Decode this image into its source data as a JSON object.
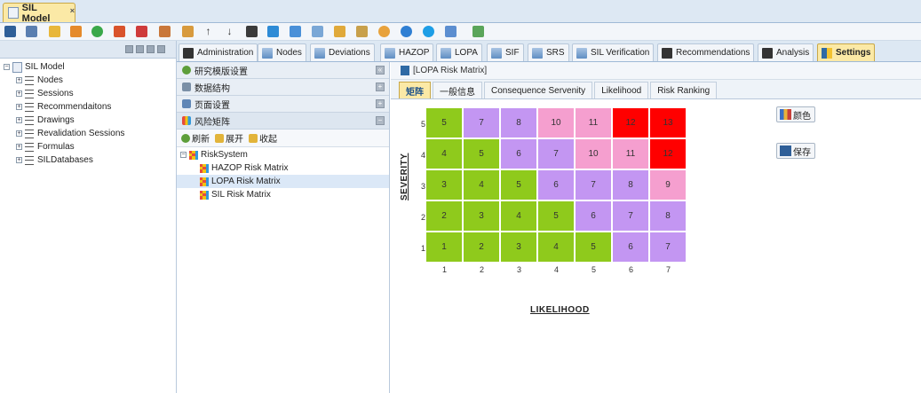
{
  "document_tab": {
    "title": "SIL Model",
    "close": "×"
  },
  "toolbar": {
    "icons": [
      "save-icon",
      "save-as-icon",
      "folder-icon",
      "edit-icon",
      "add-icon",
      "cut-icon",
      "delete-icon",
      "copy-icon",
      "paste-icon",
      "up-arrow-icon",
      "down-arrow-icon",
      "indent-icon",
      "table-icon",
      "window-icon",
      "grid-icon",
      "filter-icon",
      "tool-icon",
      "plugin-icon",
      "refresh-icon",
      "help-icon",
      "dropdown-icon",
      "export-icon"
    ],
    "up": "↑",
    "down": "↓"
  },
  "tree": {
    "root": "SIL Model",
    "items": [
      {
        "label": "Nodes"
      },
      {
        "label": "Sessions"
      },
      {
        "label": "Recommendaitons"
      },
      {
        "label": "Drawings"
      },
      {
        "label": "Revalidation Sessions"
      },
      {
        "label": "Formulas"
      },
      {
        "label": "SILDatabases"
      }
    ]
  },
  "main_tabs": [
    {
      "label": "Administration",
      "icon": "dark"
    },
    {
      "label": "Nodes",
      "icon": "blue"
    },
    {
      "label": "Deviations",
      "icon": "blue"
    },
    {
      "label": "HAZOP",
      "icon": "blue"
    },
    {
      "label": "LOPA",
      "icon": "blue"
    },
    {
      "label": "SIF",
      "icon": "blue"
    },
    {
      "label": "SRS",
      "icon": "blue"
    },
    {
      "label": "SIL Verification",
      "icon": "blue"
    },
    {
      "label": "Recommendations",
      "icon": "dark"
    },
    {
      "label": "Analysis",
      "icon": "dark"
    },
    {
      "label": "Settings",
      "icon": "set",
      "active": true
    }
  ],
  "accordion": {
    "sections": [
      {
        "label": "研究模版设置",
        "btn": "«"
      },
      {
        "label": "数据结构",
        "btn": "+"
      },
      {
        "label": "页面设置",
        "btn": "+"
      },
      {
        "label": "风险矩阵",
        "btn": "−"
      }
    ],
    "actions": {
      "refresh": "刷新",
      "expand": "展开",
      "collapse": "收起"
    },
    "risk_system": {
      "root": "RiskSystem",
      "children": [
        "HAZOP Risk Matrix",
        "LOPA Risk Matrix",
        "SIL Risk Matrix"
      ],
      "selected_index": 1
    }
  },
  "content": {
    "title": "[LOPA Risk Matrix]",
    "subtabs": [
      {
        "label": "矩阵",
        "active": true
      },
      {
        "label": "一般信息"
      },
      {
        "label": "Consequence Servenity"
      },
      {
        "label": "Likelihood"
      },
      {
        "label": "Risk Ranking"
      }
    ],
    "buttons": {
      "color": "颜色",
      "save": "保存"
    }
  },
  "matrix": {
    "severity_label": "SEVERITY",
    "likelihood_label": "LIKELIHOOD",
    "severity_ticks": [
      "5",
      "4",
      "3",
      "2",
      "1"
    ],
    "likelihood_ticks": [
      "1",
      "2",
      "3",
      "4",
      "5",
      "6",
      "7"
    ],
    "colors": {
      "green": "#8fca1c",
      "purple": "#c396f2",
      "pink": "#f59fcf",
      "red": "#ff0000"
    },
    "rows": [
      {
        "values": [
          "5",
          "7",
          "8",
          "10",
          "11",
          "12",
          "13"
        ],
        "colors": [
          "green",
          "purple",
          "purple",
          "pink",
          "pink",
          "red",
          "red"
        ]
      },
      {
        "values": [
          "4",
          "5",
          "6",
          "7",
          "10",
          "11",
          "12"
        ],
        "colors": [
          "green",
          "green",
          "purple",
          "purple",
          "pink",
          "pink",
          "red"
        ]
      },
      {
        "values": [
          "3",
          "4",
          "5",
          "6",
          "7",
          "8",
          "9"
        ],
        "colors": [
          "green",
          "green",
          "green",
          "purple",
          "purple",
          "purple",
          "pink"
        ]
      },
      {
        "values": [
          "2",
          "3",
          "4",
          "5",
          "6",
          "7",
          "8"
        ],
        "colors": [
          "green",
          "green",
          "green",
          "green",
          "purple",
          "purple",
          "purple"
        ]
      },
      {
        "values": [
          "1",
          "2",
          "3",
          "4",
          "5",
          "6",
          "7"
        ],
        "colors": [
          "green",
          "green",
          "green",
          "green",
          "green",
          "purple",
          "purple"
        ]
      }
    ]
  }
}
